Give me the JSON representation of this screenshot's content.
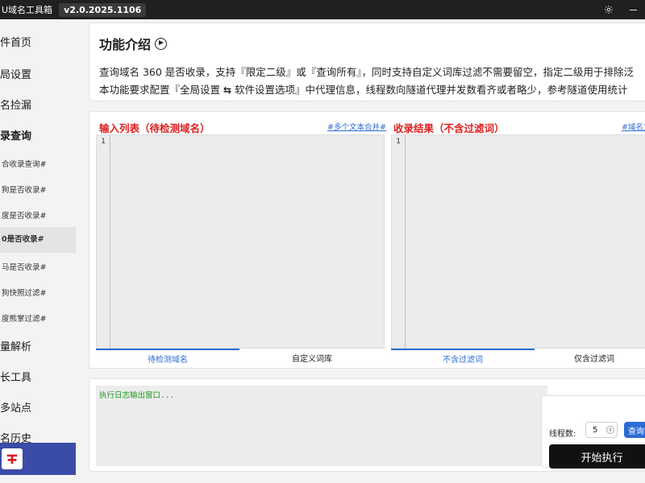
{
  "window": {
    "title": "U域名工具箱",
    "version": "v2.0.2025.1106"
  },
  "sidebar": {
    "items": [
      {
        "label": "件首页"
      },
      {
        "label": "局设置"
      },
      {
        "label": "名捡漏"
      },
      {
        "label": "录查询"
      },
      {
        "label": "合收录查询#"
      },
      {
        "label": "狗是否收录#"
      },
      {
        "label": "度是否收录#"
      },
      {
        "label": "0是否收录#"
      },
      {
        "label": "马是否收录#"
      },
      {
        "label": "狗快照过滤#"
      },
      {
        "label": "度熊掌过滤#"
      },
      {
        "label": "量解析"
      },
      {
        "label": "长工具"
      },
      {
        "label": "多站点"
      },
      {
        "label": "名历史"
      }
    ]
  },
  "intro": {
    "title": "功能介绍",
    "line1": "查询域名 360 是否收录，支持『限定二级』或『查询所有』，同时支持自定义词库过滤不需要留空，指定二级用于排除泛",
    "line2_before": "本功能要求配置『全局设置 ",
    "line2_after": " 软件设置选项』中代理信息，线程数向隧道代理并发数看齐或者略少，参考隧道使用统计"
  },
  "left_panel": {
    "title": "输入列表（待检测域名）",
    "link": "#多个文本合并#",
    "line_number": "1",
    "tabs": [
      "待检测域名",
      "自定义词库"
    ]
  },
  "right_panel": {
    "title": "收录结果（不含过滤词）",
    "link": "#域名文",
    "line_number": "1",
    "tabs": [
      "不含过滤词",
      "仅含过滤词"
    ]
  },
  "log": {
    "placeholder": "执行日志输出窗口..."
  },
  "controls": {
    "threads_label": "线程数:",
    "threads_value": "5",
    "query_label": "查询",
    "start_label": "开始执行"
  }
}
